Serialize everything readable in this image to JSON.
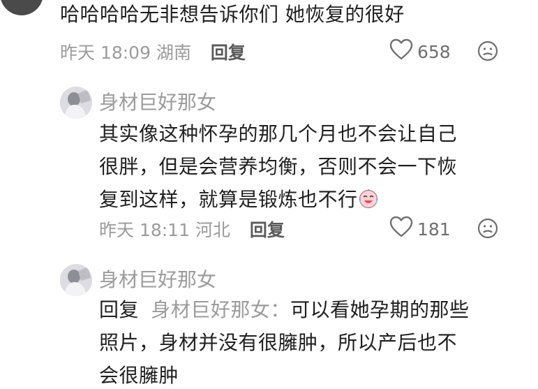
{
  "comment1": {
    "text": "哈哈哈哈无非想告诉你们 她恢复的很好",
    "time": "昨天 18:09",
    "location": "湖南",
    "reply_label": "回复",
    "likes": "658"
  },
  "reply1": {
    "username": "身材巨好那女",
    "lines": [
      "其实像这种怀孕的那几个月也不会让自己",
      "很胖，但是会营养均衡，否则不会一下恢",
      "复到这样，就算是锻炼也不行"
    ],
    "emoji_icon": "crying-laughing-emoji",
    "time": "昨天 18:11",
    "location": "河北",
    "reply_label": "回复",
    "likes": "181"
  },
  "reply2": {
    "username": "身材巨好那女",
    "prefix": "回复",
    "target": "身材巨好那女：",
    "line1_rest": "可以看她孕期的那些",
    "lines": [
      "照片，身材并没有很臃肿，所以产后也不",
      "会很臃肿"
    ]
  },
  "icons": {
    "like": "heart-outline-icon",
    "dislike": "frown-face-icon"
  }
}
